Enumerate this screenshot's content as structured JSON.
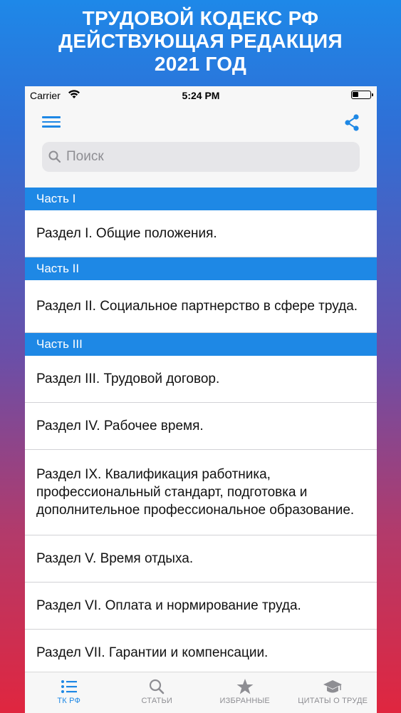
{
  "promo": {
    "line1": "ТРУДОВОЙ КОДЕКС РФ",
    "line2": "ДЕЙСТВУЮЩАЯ РЕДАКЦИЯ",
    "line3": "2021 ГОД"
  },
  "status_bar": {
    "carrier": "Carrier",
    "time": "5:24 PM"
  },
  "nav": {
    "menu_icon": "hamburger-menu-icon",
    "share_icon": "share-icon"
  },
  "search": {
    "placeholder": "Поиск",
    "icon": "search-icon"
  },
  "sections": [
    {
      "header": "Часть I",
      "rows": [
        "Раздел I. Общие положения."
      ]
    },
    {
      "header": "Часть II",
      "rows": [
        "Раздел II. Социальное партнерство в сфере труда."
      ]
    },
    {
      "header": "Часть III",
      "rows": [
        "Раздел III. Трудовой договор.",
        "Раздел IV. Рабочее время.",
        "Раздел IX. Квалификация работника, профессиональный стандарт, подготовка и дополнительное профессиональное образование.",
        "Раздел V. Время отдыха.",
        "Раздел VI. Оплата и нормирование труда.",
        "Раздел VII. Гарантии и компенсации."
      ]
    }
  ],
  "tabbar": {
    "tabs": [
      {
        "label": "ТК РФ",
        "icon": "list-icon",
        "active": true
      },
      {
        "label": "СТАТЬИ",
        "icon": "search-icon",
        "active": false
      },
      {
        "label": "ИЗБРАННЫЕ",
        "icon": "star-icon",
        "active": false
      },
      {
        "label": "ЦИТАТЫ О ТРУДЕ",
        "icon": "graduation-cap-icon",
        "active": false
      }
    ]
  },
  "colors": {
    "accent": "#1e88e5",
    "section_header_bg": "#1e88e5",
    "inactive_tab": "#8e8e93"
  }
}
